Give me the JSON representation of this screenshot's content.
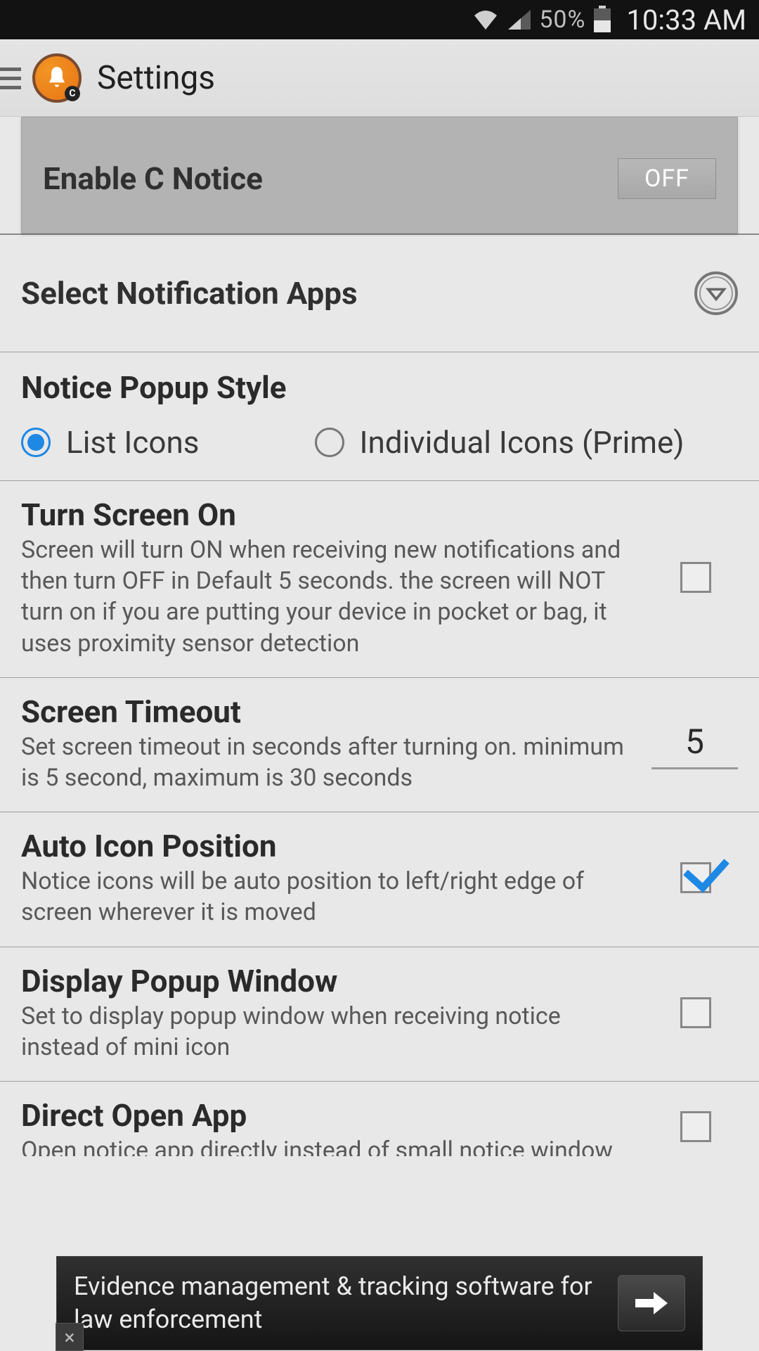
{
  "status": {
    "battery_pct": "50%",
    "clock": "10:33 AM"
  },
  "appbar": {
    "title": "Settings",
    "badge": "C"
  },
  "rows": {
    "enable": {
      "label": "Enable C Notice",
      "state": "OFF"
    },
    "select_apps": {
      "label": "Select Notification Apps"
    },
    "popup_style": {
      "title": "Notice Popup Style",
      "option1": "List Icons",
      "option2": "Individual Icons (Prime)",
      "selected": "option1"
    },
    "turn_screen": {
      "title": "Turn Screen On",
      "desc": "Screen will turn ON when receiving new notifications and then turn OFF in Default 5 seconds. the screen will NOT turn on if you are putting your device in pocket or bag, it uses proximity sensor detection",
      "checked": false
    },
    "screen_timeout": {
      "title": "Screen Timeout",
      "desc": "Set screen timeout in seconds after turning on. minimum is 5 second, maximum is 30 seconds",
      "value": "5"
    },
    "auto_icon": {
      "title": "Auto Icon Position",
      "desc": "Notice icons will be auto position to left/right edge of screen wherever it is moved",
      "checked": true
    },
    "display_popup": {
      "title": "Display Popup Window",
      "desc": "Set to display popup window when receiving notice instead of mini icon",
      "checked": false
    },
    "direct_open": {
      "title": "Direct Open App",
      "desc": "Open notice app directly instead of small notice window",
      "checked": false
    }
  },
  "ad": {
    "text": "Evidence management & tracking software for law enforcement",
    "close": "×"
  }
}
